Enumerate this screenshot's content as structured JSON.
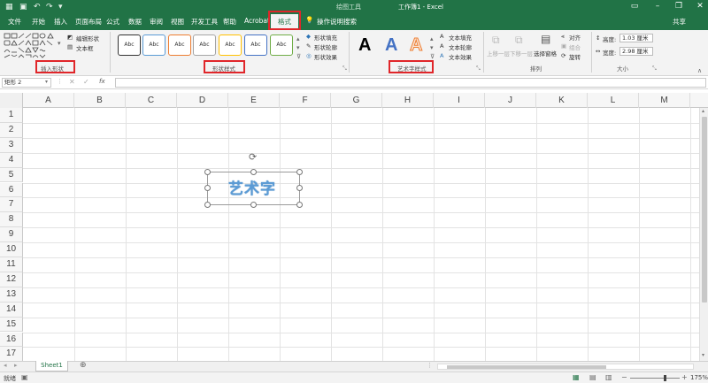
{
  "title_bar": {
    "context_tab_group": "绘图工具",
    "document_title": "工作簿1 - Excel",
    "window_controls": [
      "minimize-icon",
      "restore-icon",
      "close-icon"
    ]
  },
  "tabs": [
    "文件",
    "开始",
    "插入",
    "页面布局",
    "公式",
    "数据",
    "审阅",
    "视图",
    "开发工具",
    "帮助",
    "Acrobat",
    "格式"
  ],
  "active_tab": "格式",
  "tell_me": "操作说明搜索",
  "share_label": "共享",
  "ribbon": {
    "insert_shapes": {
      "label": "插入形状",
      "edit_shape": "编辑形状",
      "text_box": "文本框"
    },
    "shape_styles": {
      "label": "形状样式",
      "sample_text": "Abc",
      "samples": [
        {
          "border": "#333333"
        },
        {
          "border": "#5b9bd5"
        },
        {
          "border": "#ed7d31"
        },
        {
          "border": "#a5a5a5"
        },
        {
          "border": "#ffc000"
        },
        {
          "border": "#4472c4"
        },
        {
          "border": "#70ad47"
        }
      ],
      "fill": "形状填充",
      "outline": "形状轮廓",
      "effects": "形状效果"
    },
    "wordart_styles": {
      "label": "艺术字样式",
      "letters": [
        {
          "text": "A",
          "color": "#000000"
        },
        {
          "text": "A",
          "color": "#4472c4"
        },
        {
          "text": "A",
          "color": "#ed7d31"
        }
      ],
      "text_fill": "文本填充",
      "text_outline": "文本轮廓",
      "text_effects": "文本效果"
    },
    "arrange": {
      "label": "排列",
      "bring_forward": "上移一层",
      "send_backward": "下移一层",
      "selection_pane": "选择窗格",
      "align": "对齐",
      "group": "组合",
      "rotate": "旋转"
    },
    "size": {
      "label": "大小",
      "height_label": "高度:",
      "height_value": "1.03 厘米",
      "width_label": "宽度:",
      "width_value": "2.98 厘米"
    }
  },
  "formula_bar": {
    "name_box": "矩形 2",
    "fx": "fx",
    "value": ""
  },
  "grid": {
    "columns": [
      "A",
      "B",
      "C",
      "D",
      "E",
      "F",
      "G",
      "H",
      "I",
      "J",
      "K",
      "L",
      "M"
    ],
    "rows": [
      "1",
      "2",
      "3",
      "4",
      "5",
      "6",
      "7",
      "8",
      "9",
      "10",
      "11",
      "12",
      "13",
      "14",
      "15",
      "16",
      "17"
    ]
  },
  "shape": {
    "text": "艺术字"
  },
  "sheets": [
    "Sheet1"
  ],
  "status": {
    "ready": "就绪",
    "zoom": "175%"
  },
  "colors": {
    "accent": "#217346",
    "highlight": "#e0262a",
    "wordart": "#5b9bd5"
  }
}
